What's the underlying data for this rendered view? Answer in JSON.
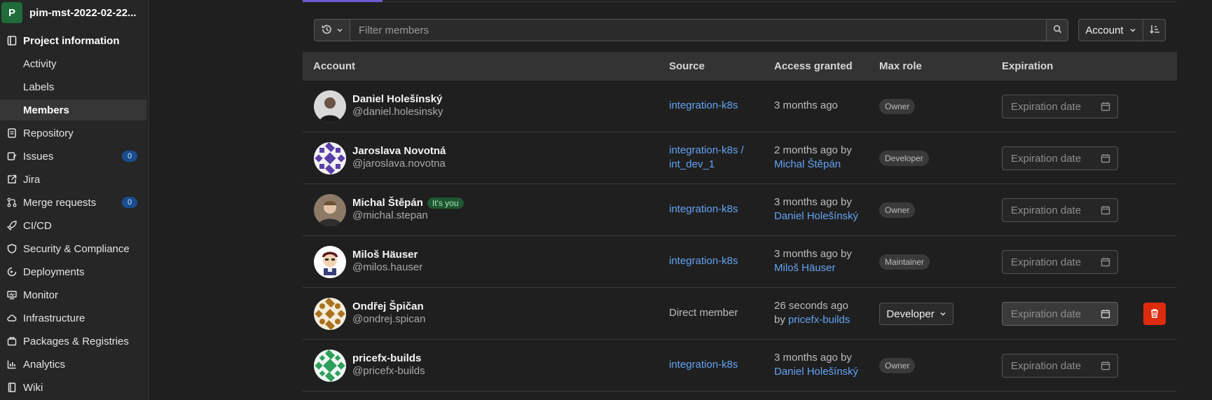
{
  "project": {
    "initial": "P",
    "name": "pim-mst-2022-02-22..."
  },
  "sidebar": {
    "items": [
      {
        "label": "Project information",
        "icon": "project-icon"
      },
      {
        "label": "Activity"
      },
      {
        "label": "Labels"
      },
      {
        "label": "Members"
      },
      {
        "label": "Repository",
        "icon": "repository-icon"
      },
      {
        "label": "Issues",
        "icon": "issues-icon",
        "badge": "0"
      },
      {
        "label": "Jira",
        "icon": "external-link-icon"
      },
      {
        "label": "Merge requests",
        "icon": "merge-request-icon",
        "badge": "0"
      },
      {
        "label": "CI/CD",
        "icon": "rocket-icon"
      },
      {
        "label": "Security & Compliance",
        "icon": "shield-icon"
      },
      {
        "label": "Deployments",
        "icon": "deployments-icon"
      },
      {
        "label": "Monitor",
        "icon": "monitor-icon"
      },
      {
        "label": "Infrastructure",
        "icon": "cloud-icon"
      },
      {
        "label": "Packages & Registries",
        "icon": "package-icon"
      },
      {
        "label": "Analytics",
        "icon": "chart-icon"
      },
      {
        "label": "Wiki",
        "icon": "book-icon"
      }
    ]
  },
  "filter": {
    "placeholder": "Filter members"
  },
  "sort": {
    "label": "Account"
  },
  "table": {
    "headers": {
      "account": "Account",
      "source": "Source",
      "access": "Access granted",
      "role": "Max role",
      "expiration": "Expiration"
    },
    "expiration_placeholder": "Expiration date",
    "rows": [
      {
        "name": "Daniel Holešínský",
        "username": "@daniel.holesinsky",
        "source_line1": "integration-k8s",
        "source_line2": "",
        "access_line1": "3 months ago",
        "access_line2": "",
        "access_by": "",
        "role": "Owner"
      },
      {
        "name": "Jaroslava Novotná",
        "username": "@jaroslava.novotna",
        "source_line1": "integration-k8s /",
        "source_line2": "int_dev_1",
        "access_line1": "2 months ago by",
        "access_line2": "",
        "access_by": "Michal Štěpán",
        "role": "Developer"
      },
      {
        "name": "Michal Štěpán",
        "username": "@michal.stepan",
        "badge": "It's you",
        "source_line1": "integration-k8s",
        "source_line2": "",
        "access_line1": "3 months ago by",
        "access_line2": "",
        "access_by": "Daniel Holešínský",
        "role": "Owner"
      },
      {
        "name": "Miloš Häuser",
        "username": "@milos.hauser",
        "source_line1": "integration-k8s",
        "source_line2": "",
        "access_line1": "3 months ago by",
        "access_line2": "",
        "access_by": "Miloš Häuser",
        "role": "Maintainer"
      },
      {
        "name": "Ondřej Špičan",
        "username": "@ondrej.spican",
        "source_line1": "Direct member",
        "source_line2": "",
        "access_line1": "26 seconds ago",
        "access_line2": "by ",
        "access_by": "pricefx-builds",
        "role": "Developer"
      },
      {
        "name": "pricefx-builds",
        "username": "@pricefx-builds",
        "source_line1": "integration-k8s",
        "source_line2": "",
        "access_line1": "3 months ago by",
        "access_line2": "",
        "access_by": "Daniel Holešínský",
        "role": "Owner"
      }
    ]
  },
  "colors": {
    "link": "#63a3f2",
    "accent": "#6e5ad2",
    "danger": "#dd2b0e"
  }
}
